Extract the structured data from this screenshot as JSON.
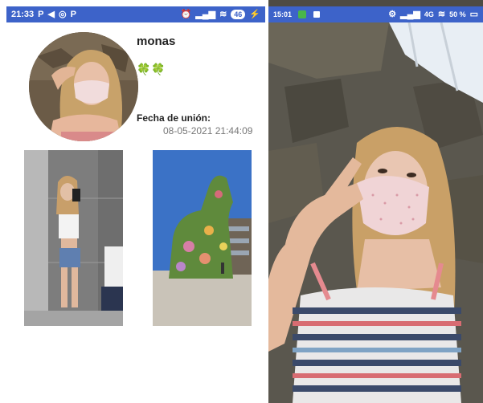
{
  "left_screen": {
    "statusbar": {
      "time": "21:33",
      "left_icons": [
        "parking-icon",
        "telegram-icon",
        "whatsapp-icon",
        "parking-icon"
      ],
      "right_icons": [
        "alarm-icon",
        "signal-icon",
        "wifi-icon"
      ],
      "battery": "46",
      "charging_glyph": "⚡",
      "bg_color": "#3d63c9"
    },
    "profile": {
      "username": "monas",
      "bio": "🍀🍀",
      "join_label": "Fecha de unión:",
      "join_date": "08-05-2021 21:44:09"
    }
  },
  "right_screen": {
    "statusbar": {
      "time": "15:01",
      "network": "4G",
      "battery": "50 %",
      "bg_color": "#3d63c9"
    }
  }
}
